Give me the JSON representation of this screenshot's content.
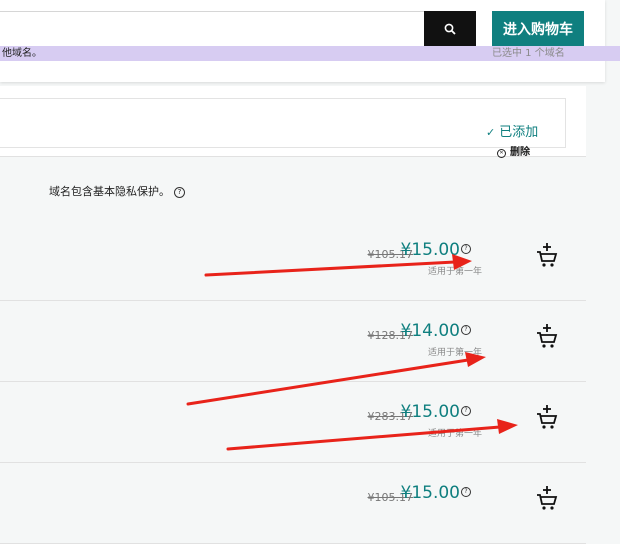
{
  "header": {
    "search_icon": "search-icon",
    "cart_button_label": "进入购物车",
    "hint_text": "他域名。",
    "selected_count": "已选中 1 个域名"
  },
  "selected_domain": {
    "status_label": "已添加",
    "remove_label": "删除"
  },
  "privacy_note": "域名包含基本隐私保护。",
  "results": [
    {
      "old_price": "¥105.17",
      "price": "¥15.00",
      "period": "适用于第一年"
    },
    {
      "old_price": "¥128.17",
      "price": "¥14.00",
      "period": "适用于第一年"
    },
    {
      "old_price": "¥283.17",
      "price": "¥15.00",
      "period": "适用于第一年"
    },
    {
      "old_price": "¥105.17",
      "price": "¥15.00",
      "period": ""
    }
  ],
  "annotation_color": "#e8231a",
  "accent_color": "#0f7f7f"
}
